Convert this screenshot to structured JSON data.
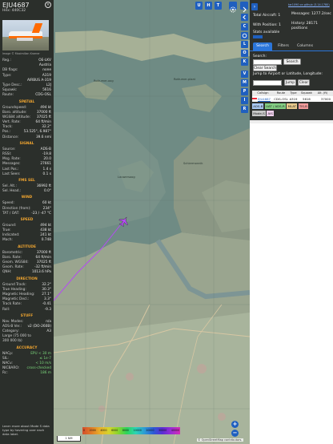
{
  "detail": {
    "callsign": "EJU4687",
    "hex_line": "Hex: 440C32",
    "close_glyph": "×",
    "photo_credit": "Image © Maximilian Kramer",
    "top_rows": [
      {
        "k": "Reg.:",
        "v": "OE-LKV"
      },
      {
        "k": "",
        "v": "Austria"
      },
      {
        "k": "DB flags:",
        "v": "none"
      },
      {
        "k": "Type:",
        "v": "A319"
      },
      {
        "k": "",
        "v": "AIRBUS A-319"
      },
      {
        "k": "Type Desc.:",
        "v": "L2J"
      },
      {
        "k": "Squawk:",
        "v": "5616"
      },
      {
        "k": "Route:",
        "v": "CDG-OSL"
      }
    ],
    "sections": [
      {
        "title": "SPATIAL",
        "rows": [
          {
            "k": "Groundspeed:",
            "v": "494 kt"
          },
          {
            "k": "Baro. altitude:",
            "v": "37000 ft"
          },
          {
            "k": "WGS84 altitude:",
            "v": "37025 ft"
          },
          {
            "k": "Vert. Rate:",
            "v": "64 ft/min"
          },
          {
            "k": "Track:",
            "v": "32.2°"
          },
          {
            "k": "Pos.:",
            "v": "53.525°, 6.987°"
          },
          {
            "k": "Distance:",
            "v": "39.6 nmi"
          }
        ]
      },
      {
        "title": "SIGNAL",
        "rows": [
          {
            "k": "Source:",
            "v": "ADS-B"
          },
          {
            "k": "RSSI:",
            "v": "-19.8"
          },
          {
            "k": "Msg. Rate:",
            "v": "20.0"
          },
          {
            "k": "Messages:",
            "v": "27661"
          },
          {
            "k": "Last Pos.:",
            "v": "1.4 s"
          },
          {
            "k": "Last Seen:",
            "v": "0.1 s"
          }
        ]
      },
      {
        "title": "FMS SEL",
        "rows": [
          {
            "k": "Sel. Alt.:",
            "v": "36992 ft"
          },
          {
            "k": "Sel. Head.:",
            "v": "0.0°"
          }
        ]
      },
      {
        "title": "WIND",
        "rows": [
          {
            "k": "Speed:",
            "v": "60 kt"
          },
          {
            "k": "Direction (from):",
            "v": "234°"
          },
          {
            "k": "TAT / OAT:",
            "v": "-23 / -47 °C"
          }
        ]
      },
      {
        "title": "SPEED",
        "rows": [
          {
            "k": "Ground:",
            "v": "494 kt"
          },
          {
            "k": "True:",
            "v": "438 kt"
          },
          {
            "k": "Indicated:",
            "v": "241 kt"
          },
          {
            "k": "Mach:",
            "v": "0.748"
          }
        ]
      },
      {
        "title": "ALTITUDE",
        "rows": [
          {
            "k": "Barometric:",
            "v": "37000 ft"
          },
          {
            "k": "Baro. Rate:",
            "v": "64 ft/min"
          },
          {
            "k": "Geom. WGS84:",
            "v": "37025 ft"
          },
          {
            "k": "Geom. Rate:",
            "v": "-32 ft/min"
          },
          {
            "k": "QNH:",
            "v": "1013.6 hPa"
          }
        ]
      },
      {
        "title": "DIRECTION",
        "rows": [
          {
            "k": "Ground Track:",
            "v": "32.2°"
          },
          {
            "k": "True Heading:",
            "v": "30.3°"
          },
          {
            "k": "Magnetic Heading:",
            "v": "27.1°"
          },
          {
            "k": "Magnetic Decl.:",
            "v": "3.3°"
          },
          {
            "k": "Track Rate:",
            "v": "-0.41"
          },
          {
            "k": "Roll:",
            "v": "-9.3"
          }
        ]
      },
      {
        "title": "STUFF",
        "rows": [
          {
            "k": "Nav. Modes:",
            "v": "n/a"
          },
          {
            "k": "ADS-B Ver.:",
            "v": "v2 (DO-260B)"
          },
          {
            "k": "Category:",
            "v": "A3"
          },
          {
            "k": "Large (75 000 to",
            "v": ""
          },
          {
            "k": "300 000 lb)",
            "v": ""
          }
        ]
      },
      {
        "title": "ACCURACY",
        "rows": [
          {
            "k": "NACp:",
            "v": "EPU < 30 m"
          },
          {
            "k": "SIL:",
            "v": "≤ 1e-7"
          },
          {
            "k": "NACv:",
            "v": "< 10 m/s"
          },
          {
            "k": "NICBARO:",
            "v": "cross-checked"
          },
          {
            "k": "Rc:",
            "v": "186 m"
          }
        ]
      }
    ],
    "footer": "Learn more about Mode S data type by hovering over each data label."
  },
  "map": {
    "top_buttons": [
      "U",
      "H",
      "T"
    ],
    "side_buttons": [
      "C",
      "O",
      "K",
      "M",
      "P",
      "I",
      "R"
    ],
    "side_buttons_2": [
      "V"
    ],
    "zoom_in": "+",
    "zoom_out": "−",
    "scale_label": "1 NM",
    "alt_ticks": [
      "0",
      "2000",
      "4000",
      "6000",
      "8000",
      "10000",
      "20000",
      "30000",
      "40000"
    ],
    "island_labels": [
      "Borkum",
      "Rottumer-oog",
      "Rottumer-plaat",
      "Schiermonnik",
      "Lauwersoog",
      "Den Helder"
    ],
    "attribution": "© OpenStreetMap contributors."
  },
  "right": {
    "link": "tar1090 on github (3.14.1780)",
    "total_aircraft": "Total Aircraft: 1",
    "with_position": "With Position: 1",
    "messages": "Messages: 1277.2/sec",
    "history": "History: 28171 positions",
    "stats": "Stats available",
    "tabs": [
      "Search",
      "Filters",
      "Columns"
    ],
    "search_label": "Search:",
    "search_button": "Search",
    "clear_search": "Clear Search",
    "jump_label": "Jump to Airport or Latitude, Longitude:",
    "jump_button": "Jump",
    "clear_button": "Clear",
    "table_headers": [
      "Callsign",
      "Route",
      "Type",
      "Squawk",
      "Alt. (ft)"
    ],
    "table_row": {
      "callsign": "EJU4687",
      "route": "CDG-OSL",
      "type": "A319",
      "squawk": "5616",
      "alt": "37000"
    },
    "chips": [
      {
        "label": "ADS-B",
        "color": "#a9c8f2"
      },
      {
        "label": "UAT / ADS-R",
        "color": "#83ce83"
      },
      {
        "label": "MLAT",
        "color": "#e8c98b"
      },
      {
        "label": "TIS-B",
        "color": "#f29c9c"
      }
    ],
    "chips2": [
      {
        "label": "Mode-S",
        "color": "#c7c7c7"
      },
      {
        "label": "AIS",
        "color": "#f2d1ef"
      }
    ]
  }
}
